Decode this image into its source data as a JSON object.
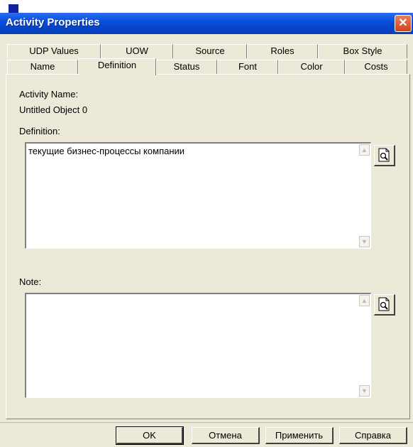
{
  "window": {
    "title": "Activity Properties",
    "close_glyph": "✕"
  },
  "tabs_row1": [
    "UDP Values",
    "UOW",
    "Source",
    "Roles",
    "Box Style"
  ],
  "tabs_row2": [
    "Name",
    "Definition",
    "Status",
    "Font",
    "Color",
    "Costs"
  ],
  "active_tab": "Definition",
  "fields": {
    "activity_name_label": "Activity Name:",
    "activity_name_value": "Untitled Object 0",
    "definition_label": "Definition:",
    "definition_text": "текущие бизнес-процессы компании",
    "note_label": "Note:",
    "note_text": ""
  },
  "icons": {
    "preview": "document-magnifier-icon",
    "scroll_up": "▲",
    "scroll_down": "▼"
  },
  "buttons": {
    "ok": "OK",
    "cancel": "Отмена",
    "apply": "Применить",
    "help": "Справка"
  }
}
